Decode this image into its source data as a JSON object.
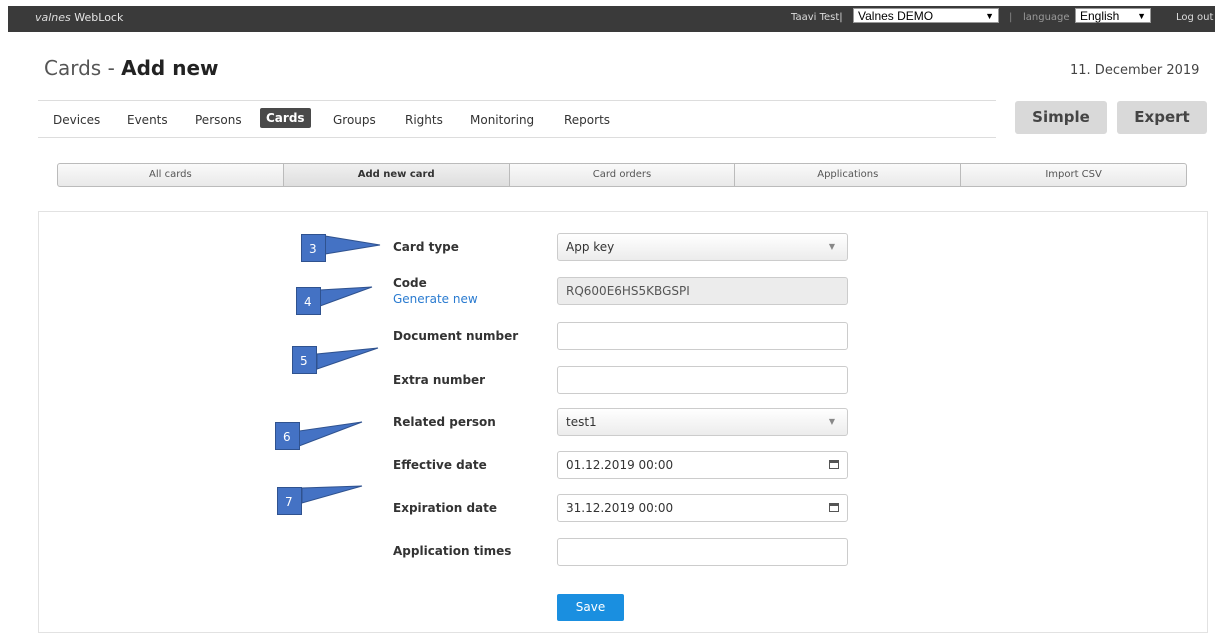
{
  "topbar": {
    "logo": "valnes",
    "logo_suffix": "WebLock",
    "user": "Taavi Test|",
    "company_selected": "Valnes DEMO",
    "separator": "|",
    "language_label": "language",
    "language_selected": "English",
    "logout": "Log out"
  },
  "header": {
    "title_prefix": "Cards - ",
    "title_main": "Add new",
    "date": "11. December 2019"
  },
  "nav": {
    "items": [
      "Devices",
      "Events",
      "Persons",
      "Cards",
      "Groups",
      "Rights",
      "Monitoring",
      "Reports"
    ],
    "active": "Cards"
  },
  "modes": {
    "simple": "Simple",
    "expert": "Expert"
  },
  "subtabs": [
    "All cards",
    "Add new card",
    "Card orders",
    "Applications",
    "Import CSV"
  ],
  "form": {
    "card_type_label": "Card type",
    "card_type_value": "App key",
    "code_label": "Code",
    "generate_link": "Generate new",
    "code_value": "RQ600E6HS5KBGSPI",
    "document_number_label": "Document number",
    "document_number_value": "",
    "extra_number_label": "Extra number",
    "extra_number_value": "",
    "related_person_label": "Related person",
    "related_person_value": "test1",
    "effective_date_label": "Effective date",
    "effective_date_value": "01.12.2019 00:00",
    "expiration_date_label": "Expiration date",
    "expiration_date_value": "31.12.2019 00:00",
    "application_times_label": "Application times",
    "application_times_value": "",
    "save_label": "Save"
  },
  "annotations": [
    "3",
    "4",
    "5",
    "6",
    "7"
  ],
  "colors": {
    "accent": "#1a8fe0",
    "annotation": "#4472c4",
    "topbar": "#3a3a3a",
    "link": "#2a7bd0"
  }
}
